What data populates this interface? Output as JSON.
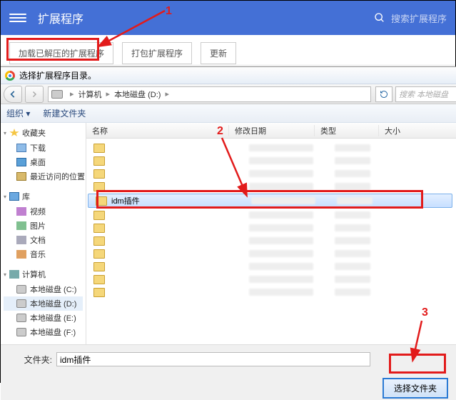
{
  "chrome": {
    "title": "扩展程序",
    "search_placeholder": "搜索扩展程序"
  },
  "toolbar": {
    "load_unpacked": "加载已解压的扩展程序",
    "pack": "打包扩展程序",
    "update": "更新"
  },
  "dialog": {
    "title": "选择扩展程序目录。",
    "breadcrumb": {
      "computer": "计算机",
      "drive": "本地磁盘 (D:)"
    },
    "search_hint": "搜索 本地磁盘",
    "orgbar": {
      "organize": "组织 ▾",
      "new_folder": "新建文件夹"
    },
    "columns": {
      "name": "名称",
      "date": "修改日期",
      "type": "类型",
      "size": "大小"
    },
    "selected_folder": "idm插件",
    "folder_label": "文件夹:",
    "folder_value": "idm插件",
    "select_btn": "选择文件夹"
  },
  "sidebar": {
    "favorites": {
      "head": "收藏夹",
      "items": [
        "下载",
        "桌面",
        "最近访问的位置"
      ]
    },
    "libraries": {
      "head": "库",
      "items": [
        "视频",
        "图片",
        "文档",
        "音乐"
      ]
    },
    "computer": {
      "head": "计算机",
      "items": [
        "本地磁盘 (C:)",
        "本地磁盘 (D:)",
        "本地磁盘 (E:)",
        "本地磁盘 (F:)"
      ]
    }
  },
  "annotations": {
    "n1": "1",
    "n2": "2",
    "n3": "3"
  }
}
